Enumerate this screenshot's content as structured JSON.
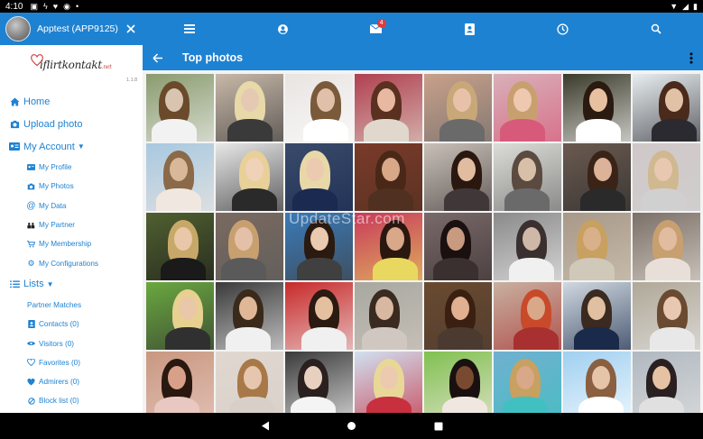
{
  "status_bar": {
    "time": "4:10"
  },
  "drawer": {
    "user_name": "Apptest (APP9125)",
    "logo_text": "iflirtkontakt",
    "logo_suffix": ".net",
    "version": "1.1.8",
    "menu": {
      "home": "Home",
      "upload_photo": "Upload photo",
      "my_account": "My Account",
      "my_profile": "My Profile",
      "my_photos": "My Photos",
      "my_data": "My Data",
      "my_partner": "My Partner",
      "my_membership": "My Membership",
      "my_configurations": "My Configurations",
      "lists": "Lists",
      "partner_matches": "Partner Matches",
      "contacts": "Contacts (0)",
      "visitors": "Visitors (0)",
      "favorites": "Favorites (0)",
      "admirers": "Admirers (0)",
      "block_list": "Block list (0)"
    }
  },
  "toolbar": {
    "messages_badge": "4"
  },
  "page": {
    "title": "Top photos"
  },
  "watermark": "UpdateStar.com",
  "colors": {
    "primary": "#1e82d2",
    "badge": "#e53935",
    "drawer_bg": "#ffffff"
  },
  "icons": [
    "menu-icon",
    "profile-icon",
    "messages-icon",
    "contact-card-icon",
    "history-icon",
    "search-icon",
    "back-arrow-icon",
    "more-vert-icon",
    "close-icon"
  ]
}
